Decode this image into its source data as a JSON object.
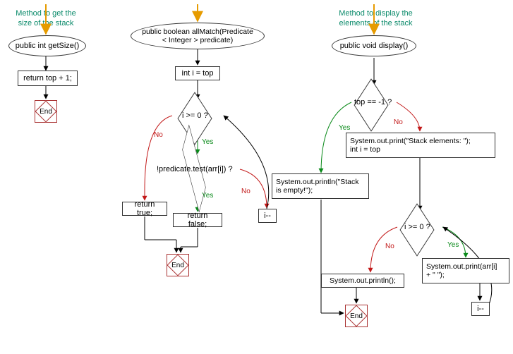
{
  "flow1": {
    "title": "Method to get the\nsize of the stack",
    "start": "public int getSize()",
    "step": "return top + 1;",
    "end": "End"
  },
  "flow2": {
    "start": "public boolean allMatch(Predicate\n< Integer > predicate)",
    "init": "int i = top",
    "cond1": "i >= 0 ?",
    "cond2": "!predicate.test(arr[i]) ?",
    "retTrue": "return true;",
    "retFalse": "return false;",
    "dec": "i--",
    "end": "End",
    "yes": "Yes",
    "no": "No"
  },
  "flow3": {
    "title": "Method to display the\nelements of the stack",
    "start": "public void display()",
    "cond1": "top == -1 ?",
    "empty": "System.out.println(\"Stack\nis empty!\");",
    "printHeader": "System.out.print(\"Stack elements: \");\nint i = top",
    "cond2": "i >= 0 ?",
    "printElem": "System.out.print(arr[i]\n+ \" \");",
    "println": "System.out.println();",
    "dec": "i--",
    "end": "End",
    "yes": "Yes",
    "no": "No"
  }
}
